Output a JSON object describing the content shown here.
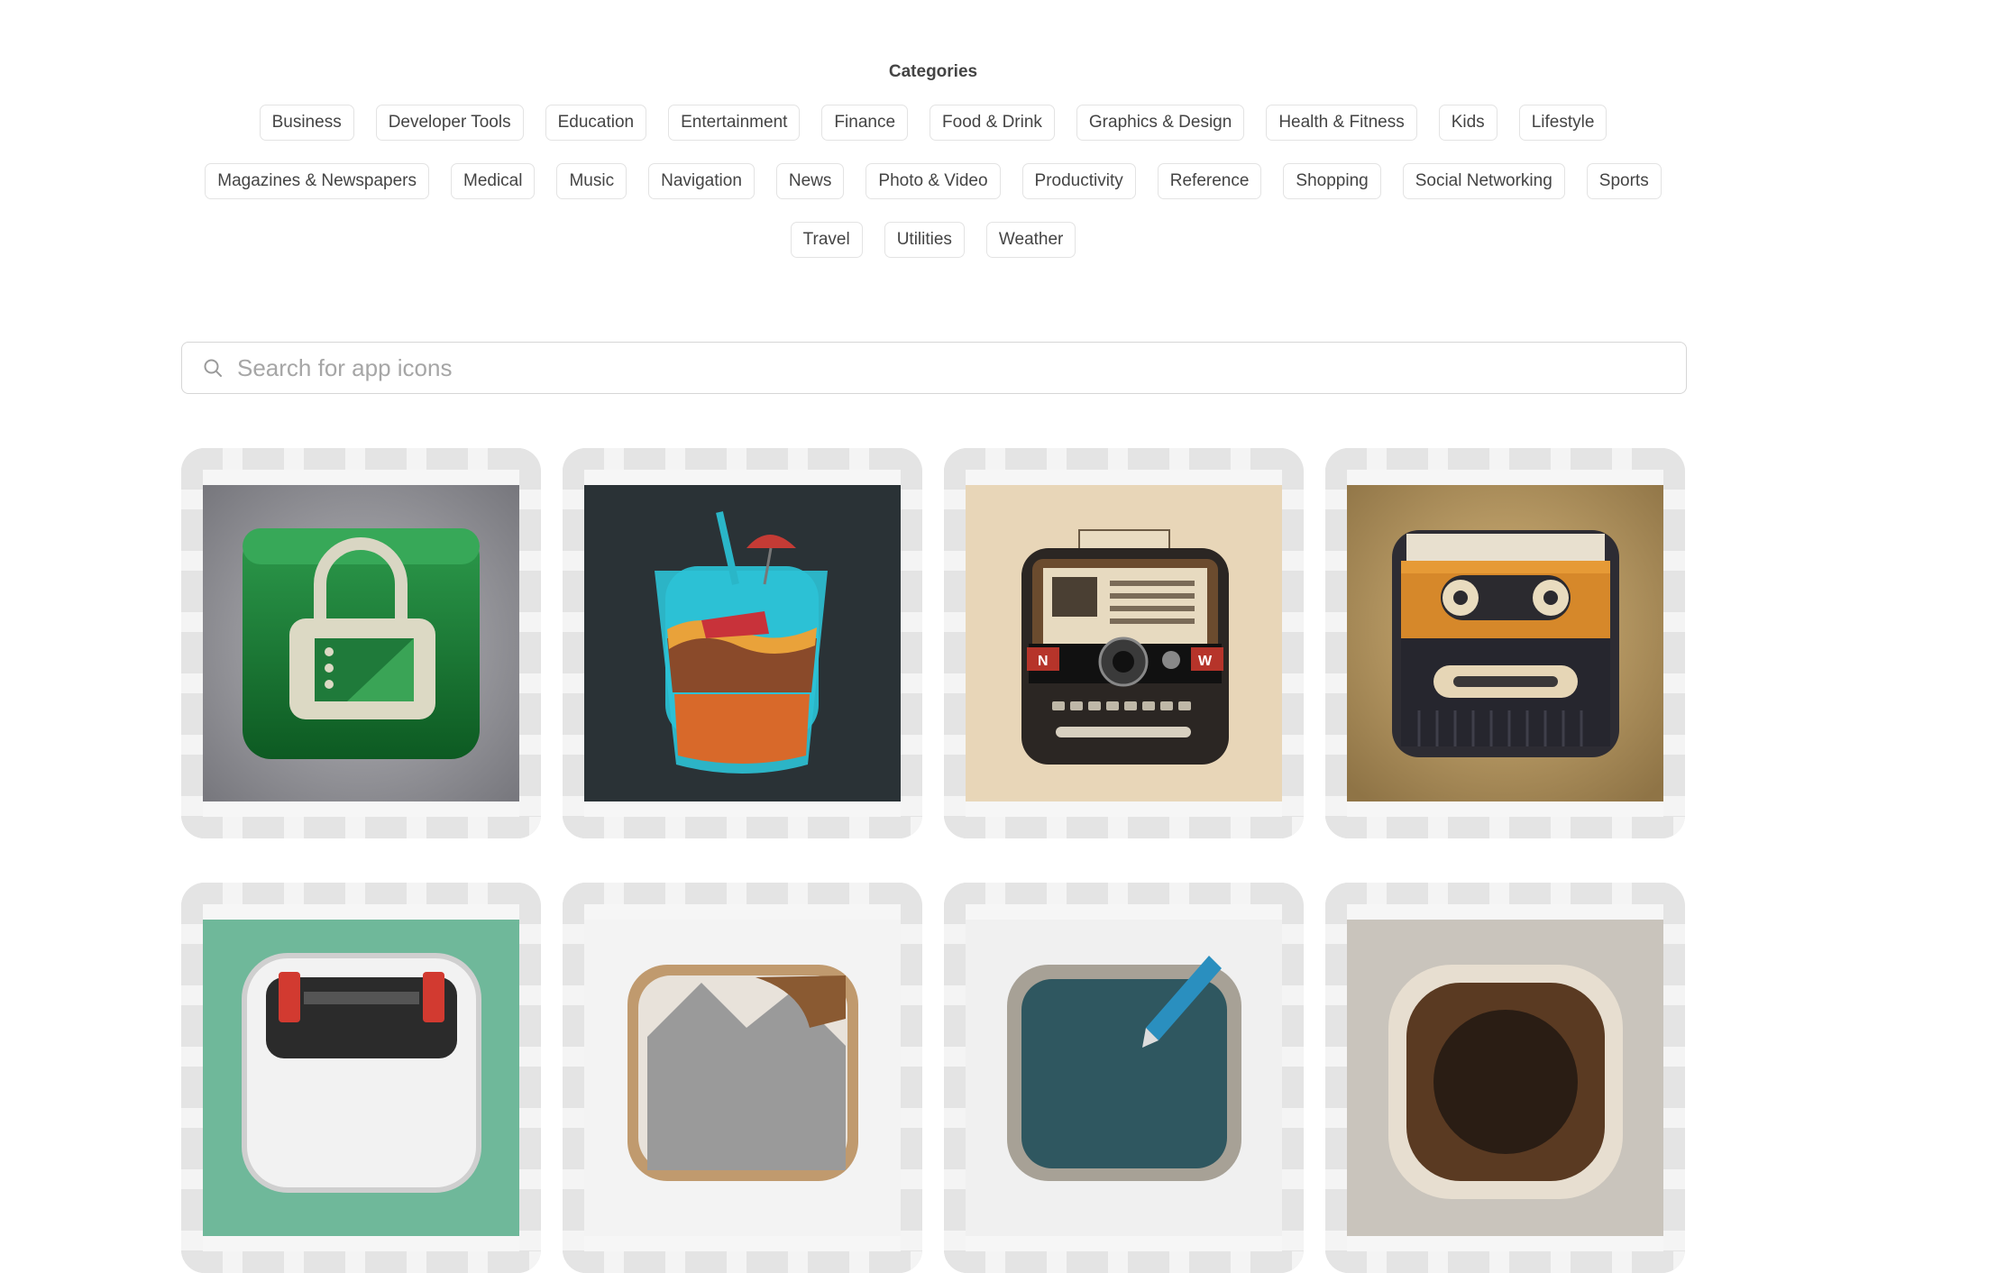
{
  "categories": {
    "title": "Categories",
    "rows": [
      [
        "Business",
        "Developer Tools",
        "Education",
        "Entertainment",
        "Finance",
        "Food & Drink",
        "Graphics & Design",
        "Health & Fitness",
        "Kids",
        "Lifestyle"
      ],
      [
        "Magazines & Newspapers",
        "Medical",
        "Music",
        "Navigation",
        "News",
        "Photo & Video",
        "Productivity",
        "Reference",
        "Shopping",
        "Social Networking",
        "Sports"
      ],
      [
        "Travel",
        "Utilities",
        "Weather"
      ]
    ]
  },
  "search": {
    "placeholder": "Search for app icons",
    "value": ""
  },
  "icon_cards": [
    {
      "icon": "shopping-bag-icon"
    },
    {
      "icon": "drink-cup-icon"
    },
    {
      "icon": "retro-radio-icon"
    },
    {
      "icon": "cassette-player-icon"
    },
    {
      "icon": "toolbox-icon"
    },
    {
      "icon": "photo-landscape-icon"
    },
    {
      "icon": "pen-tablet-icon"
    },
    {
      "icon": "camera-lens-icon"
    }
  ],
  "radio_art": {
    "left_badge": "N",
    "right_badge": "W"
  }
}
